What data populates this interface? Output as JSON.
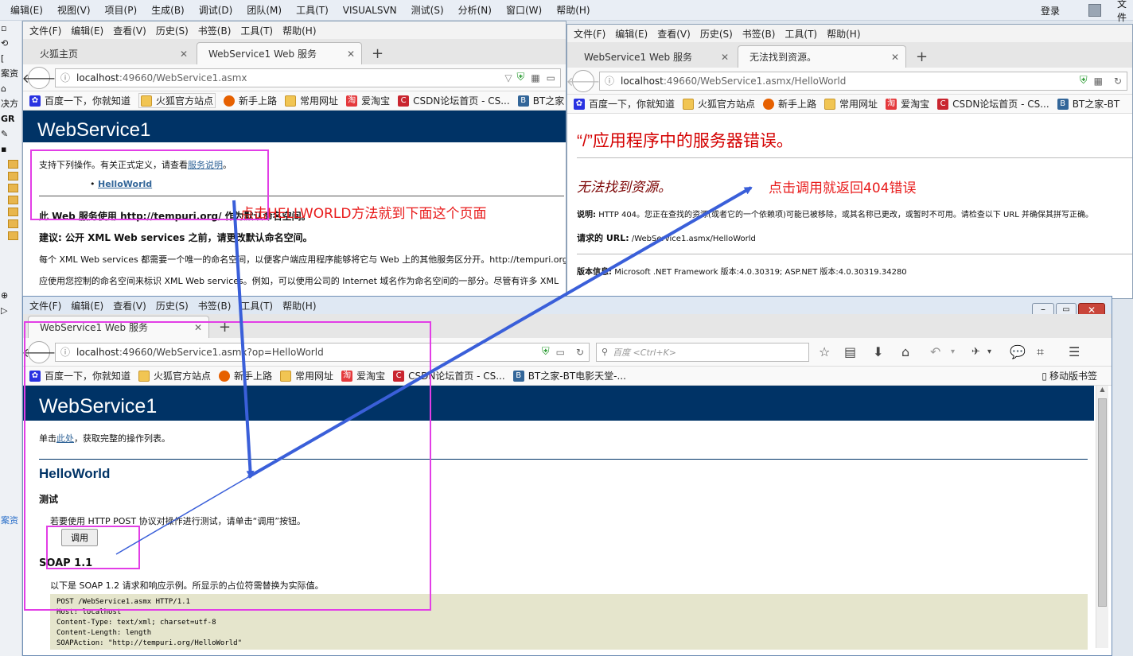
{
  "vs": {
    "menu": [
      "编辑(E)",
      "视图(V)",
      "项目(P)",
      "生成(B)",
      "调试(D)",
      "团队(M)",
      "工具(T)",
      "VISUALSVN",
      "测试(S)",
      "分析(N)",
      "窗口(W)",
      "帮助(H)"
    ],
    "login": "登录",
    "right_cut": "文件",
    "side_texts": [
      "▫",
      "⟲",
      "[",
      "案资",
      "⌂",
      "决方",
      "GR",
      "✎",
      "▪",
      "⊕",
      "▷",
      "案资"
    ]
  },
  "browser_menu": [
    "文件(F)",
    "编辑(E)",
    "查看(V)",
    "历史(S)",
    "书签(B)",
    "工具(T)",
    "帮助(H)"
  ],
  "bookmarks": [
    {
      "label": "百度一下，你就知道",
      "icon": "baidu-paw-icon"
    },
    {
      "label": "火狐官方站点",
      "icon": "folder-icon"
    },
    {
      "label": "新手上路",
      "icon": "firefox-icon"
    },
    {
      "label": "常用网址",
      "icon": "folder-icon"
    },
    {
      "label": "爱淘宝",
      "icon": "taobao-icon"
    },
    {
      "label": "CSDN论坛首页 - CS...",
      "icon": "csdn-icon"
    },
    {
      "label": "BT之家-BT电影天堂-...",
      "icon": "bt-icon"
    }
  ],
  "w1": {
    "tabs": [
      "火狐主页",
      "WebService1 Web 服务"
    ],
    "url_host": "localhost",
    "url_rest": ":49660/WebService1.asmx",
    "bt_cut": "BT之家",
    "header": "WebService1",
    "intro_a": "支持下列操作。有关正式定义，请查看",
    "intro_link": "服务说明",
    "intro_b": "。",
    "op": "HelloWorld",
    "ns_line": "此 Web 服务使用 http://tempuri.org/ 作为默认命名空间。",
    "suggest": "建议: 公开 XML Web services 之前，请更改默认命名空间。",
    "para1": "每个 XML Web services 都需要一个唯一的命名空间，以便客户端应用程序能够将它与 Web 上的其他服务区分开。http://tempuri.org/",
    "para2": "应使用您控制的命名空间来标识 XML Web services。例如，可以使用公司的 Internet 域名作为命名空间的一部分。尽管有许多 XML"
  },
  "w2": {
    "tabs": [
      "WebService1 Web 服务",
      "无法找到资源。"
    ],
    "url_host": "localhost",
    "url_rest": ":49660/WebService1.asmx/HelloWorld",
    "bt_cut": "BT之家-BT",
    "err_title": "“/”应用程序中的服务器错误。",
    "err_sub": "无法找到资源。",
    "desc_label": "说明:",
    "desc": "HTTP 404。您正在查找的资源(或者它的一个依赖项)可能已被移除，或其名称已更改，或暂时不可用。请检查以下 URL 并确保其拼写正确。",
    "url_label": "请求的 URL:",
    "req_url": "/WebService1.asmx/HelloWorld",
    "ver_label": "版本信息:",
    "ver": "Microsoft .NET Framework 版本:4.0.30319; ASP.NET 版本:4.0.30319.34280"
  },
  "w3": {
    "tab": "WebService1 Web 服务",
    "url_host": "localhost",
    "url_rest": ":49660/WebService1.asmx?op=HelloWorld",
    "search_placeholder": "百度 <Ctrl+K>",
    "mobile_bm": "移动版书签",
    "header": "WebService1",
    "click_a": "单击",
    "click_link": "此处",
    "click_b": "，获取完整的操作列表。",
    "op_title": "HelloWorld",
    "test_label": "测试",
    "test_desc": "若要使用 HTTP POST 协议对操作进行测试，请单击“调用”按钮。",
    "invoke": "调用",
    "soap_title": "SOAP 1.1",
    "soap_desc": "以下是 SOAP 1.2 请求和响应示例。所显示的占位符需替换为实际值。",
    "code": [
      "POST /WebService1.asmx HTTP/1.1",
      "Host: localhost",
      "Content-Type: text/xml; charset=utf-8",
      "Content-Length: length",
      "SOAPAction: \"http://tempuri.org/HelloWorld\""
    ]
  },
  "annotations": {
    "text1": "点击HELLWORLD方法就到下面这个页面",
    "text2": "点击调用就返回404错误"
  },
  "colors": {
    "annotation_box": "#e23ee6",
    "annotation_text": "#e81b1b",
    "arrow": "#3a5fd9",
    "ws_header": "#003366"
  }
}
